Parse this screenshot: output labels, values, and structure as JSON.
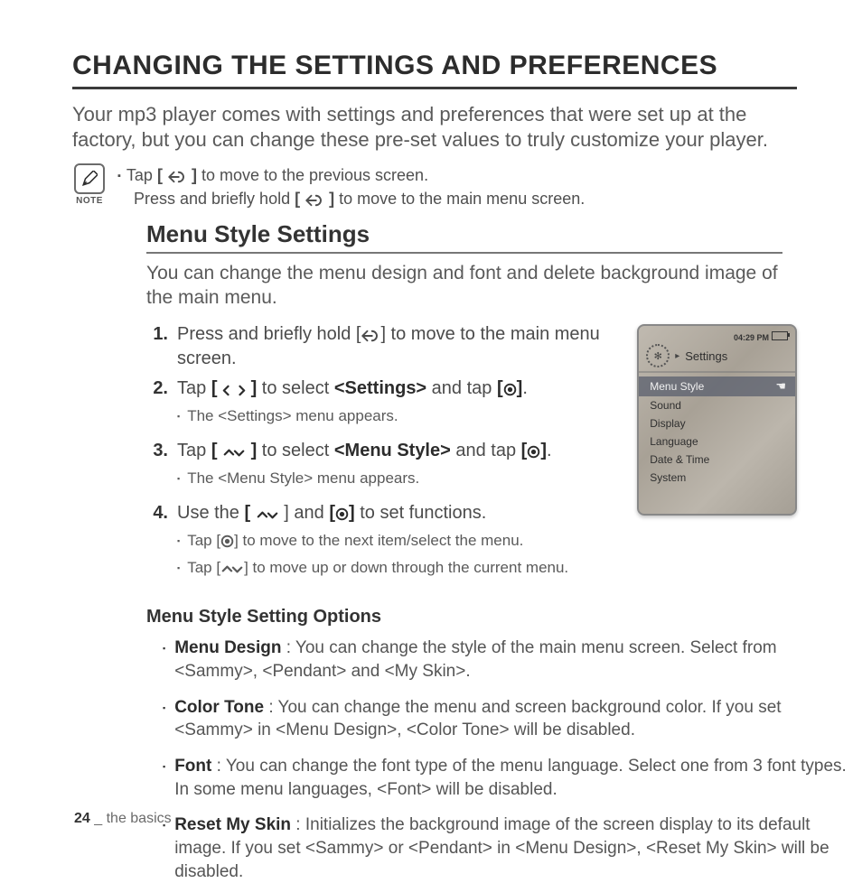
{
  "title": "CHANGING THE SETTINGS AND PREFERENCES",
  "intro": "Your mp3 player comes with settings and preferences that were set up at the factory, but you can change these pre-set values to truly customize your player.",
  "note": {
    "label": "NOTE",
    "line1_a": "Tap ",
    "line1_b": " to move to the previous screen.",
    "line2_a": "Press and briefly hold ",
    "line2_b": " to move to the main menu screen."
  },
  "section": {
    "heading": "Menu Style Settings",
    "intro": "You can change the menu design and font and delete background image of the main menu.",
    "steps": [
      {
        "num": "1.",
        "a": "Press and briefly hold [",
        "b": "] to move to the main menu screen."
      },
      {
        "num": "2.",
        "a": "Tap ",
        "mid1": " to select ",
        "target": "<Settings>",
        "mid2": " and tap ",
        "end": ".",
        "sub": "The <Settings> menu appears."
      },
      {
        "num": "3.",
        "a": "Tap ",
        "mid1": " to select ",
        "target": "<Menu Style>",
        "mid2": " and tap ",
        "end": ".",
        "sub": "The <Menu Style> menu appears."
      },
      {
        "num": "4.",
        "a": "Use the ",
        "mid": " and ",
        "b": " to set functions.",
        "sub1": "Tap [",
        "sub1b": "] to move to the next item/select the menu.",
        "sub2": "Tap [",
        "sub2b": "] to move up or down through the current menu."
      }
    ]
  },
  "device": {
    "time": "04:29 PM",
    "title": "Settings",
    "items": [
      "Menu Style",
      "Sound",
      "Display",
      "Language",
      "Date & Time",
      "System"
    ],
    "selected": 0
  },
  "options_heading": "Menu Style Setting Options",
  "options": [
    {
      "name": "Menu Design",
      "desc": " : You can change the style of the main menu screen. Select from <Sammy>, <Pendant> and <My Skin>."
    },
    {
      "name": "Color Tone",
      "desc": " : You can change the menu and screen background color. If you set <Sammy> in <Menu Design>, <Color Tone> will be disabled."
    },
    {
      "name": "Font",
      "desc": " : You can change the font type of the menu language. Select one from 3 font types. In some menu languages, <Font> will be disabled."
    },
    {
      "name": "Reset My Skin",
      "desc": " : Initializes the background image of the screen display to its default image. If you set <Sammy> or <Pendant> in <Menu Design>, <Reset My Skin> will be disabled."
    }
  ],
  "footer": {
    "page": "24",
    "sep": " _ ",
    "section": "the basics"
  }
}
